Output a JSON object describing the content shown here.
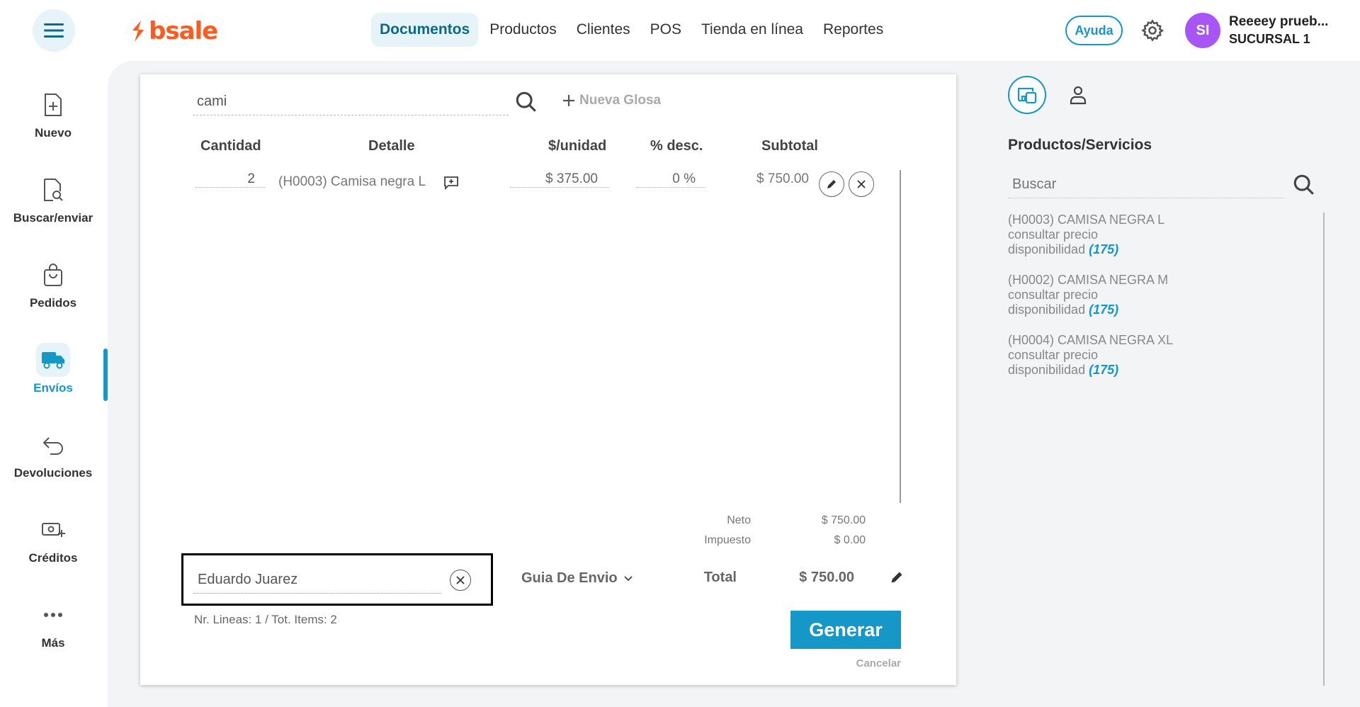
{
  "header": {
    "logo_text": "bsale",
    "nav": [
      {
        "label": "Documentos",
        "active": true
      },
      {
        "label": "Productos"
      },
      {
        "label": "Clientes"
      },
      {
        "label": "POS"
      },
      {
        "label": "Tienda en línea"
      },
      {
        "label": "Reportes"
      }
    ],
    "help_label": "Ayuda",
    "avatar_initials": "SI",
    "user_name": "Reeeey prueb...",
    "branch": "SUCURSAL 1"
  },
  "sidebar": {
    "items": [
      {
        "label": "Nuevo",
        "icon": "file-plus-icon"
      },
      {
        "label": "Buscar/enviar",
        "icon": "file-search-icon"
      },
      {
        "label": "Pedidos",
        "icon": "bag-icon"
      },
      {
        "label": "Envíos",
        "icon": "truck-icon",
        "active": true
      },
      {
        "label": "Devoluciones",
        "icon": "return-arrow-icon"
      },
      {
        "label": "Créditos",
        "icon": "money-plus-icon"
      },
      {
        "label": "Más",
        "icon": "dots-icon"
      }
    ]
  },
  "document": {
    "search_value": "cami",
    "new_glosa": "Nueva Glosa",
    "columns": {
      "qty": "Cantidad",
      "detail": "Detalle",
      "unit": "$/unidad",
      "disc": "% desc.",
      "subtotal": "Subtotal"
    },
    "lines": [
      {
        "qty": "2",
        "detail": "(H0003) Camisa negra L",
        "unit_price": "$ 375.00",
        "discount": "0 %",
        "subtotal": "$ 750.00"
      }
    ],
    "totals": {
      "neto_label": "Neto",
      "neto": "$ 750.00",
      "impuesto_label": "Impuesto",
      "impuesto": "$ 0.00",
      "total_label": "Total",
      "total": "$ 750.00"
    },
    "client_value": "Eduardo Juarez",
    "doc_type": "Guia De Envio",
    "lines_info": "Nr. Lineas: 1 / Tot. Items: 2",
    "generate_label": "Generar",
    "cancel_label": "Cancelar"
  },
  "right_panel": {
    "title": "Productos/Servicios",
    "search_placeholder": "Buscar",
    "products": [
      {
        "name": "(H0003) CAMISA NEGRA L",
        "price": "consultar precio",
        "avail_label": "disponibilidad",
        "avail": "(175)"
      },
      {
        "name": "(H0002) CAMISA NEGRA M",
        "price": "consultar precio",
        "avail_label": "disponibilidad",
        "avail": "(175)"
      },
      {
        "name": "(H0004) CAMISA NEGRA XL",
        "price": "consultar precio",
        "avail_label": "disponibilidad",
        "avail": "(175)"
      }
    ]
  },
  "colors": {
    "accent": "#1597c8",
    "brand": "#ff5a1f",
    "avatar": "#a855f7"
  }
}
